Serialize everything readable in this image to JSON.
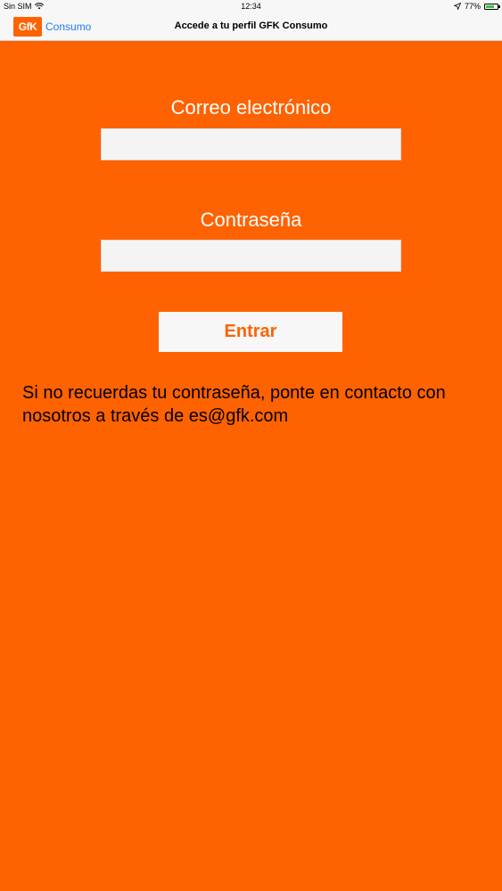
{
  "status_bar": {
    "carrier": "Sin SIM",
    "time": "12:34",
    "battery_percent": "77%",
    "battery_level": 0.77,
    "battery_color": "#3cc13c"
  },
  "nav": {
    "logo_text": "GfK",
    "back_label": "Consumo",
    "title": "Accede a tu perfil GFK Consumo"
  },
  "form": {
    "email_label": "Correo electrónico",
    "email_value": "",
    "password_label": "Contraseña",
    "password_value": "",
    "submit_label": "Entrar"
  },
  "help": {
    "text": "Si no recuerdas tu contraseña, ponte en contacto con nosotros a través de es@gfk.com"
  },
  "colors": {
    "background": "#ff6200",
    "link": "#1e7cf5"
  }
}
